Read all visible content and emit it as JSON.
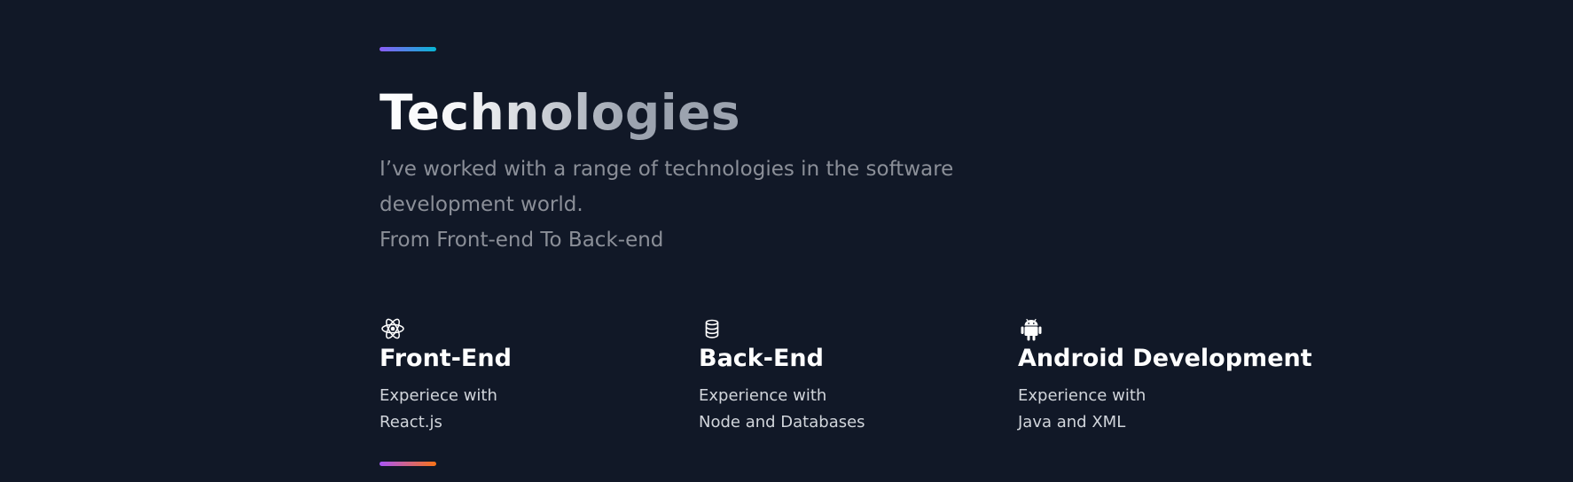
{
  "section": {
    "title": "Technologies",
    "subtitle_lines": [
      "I’ve worked with a range of technologies in the software",
      "development world.",
      "From Front-end To Back-end"
    ]
  },
  "cards": [
    {
      "icon": "react-icon",
      "title": "Front-End",
      "lines": [
        "Experiece with",
        "React.js"
      ]
    },
    {
      "icon": "database-icon",
      "title": "Back-End",
      "lines": [
        "Experience with",
        "Node and Databases"
      ]
    },
    {
      "icon": "android-icon",
      "title": "Android Development",
      "lines": [
        "Experience with",
        "Java and XML"
      ]
    }
  ],
  "colors": {
    "background": "#111827",
    "accent_top_start": "#8b5cf6",
    "accent_top_end": "#06b6d4",
    "accent_bottom_start": "#a855f7",
    "accent_bottom_end": "#f97316"
  }
}
